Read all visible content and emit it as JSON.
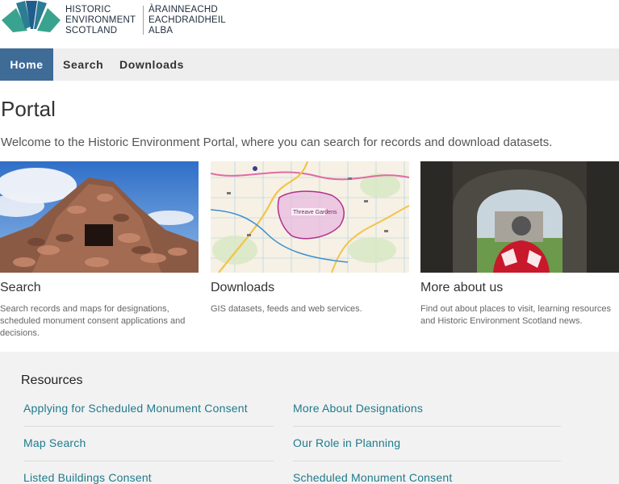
{
  "brand": {
    "en_lines": [
      "HISTORIC",
      "ENVIRONMENT",
      "SCOTLAND"
    ],
    "gd_lines": [
      "ÀRAINNEACHD",
      "EACHDRAIDHEIL",
      "ALBA"
    ]
  },
  "nav": {
    "items": [
      {
        "label": "Home",
        "active": true
      },
      {
        "label": "Search",
        "active": false
      },
      {
        "label": "Downloads",
        "active": false
      }
    ]
  },
  "page": {
    "title": "Portal",
    "intro": "Welcome to the Historic Environment Portal, where you can search for records and download datasets."
  },
  "cards": [
    {
      "title": "Search",
      "description": "Search records and maps for designations, scheduled monument consent applications and decisions."
    },
    {
      "title": "Downloads",
      "description": "GIS datasets, feeds and web services."
    },
    {
      "title": "More about us",
      "description": "Find out about places to visit, learning resources and Historic Environment Scotland news."
    }
  ],
  "map_labels": {
    "place": "Threave Gardens"
  },
  "resources": {
    "heading": "Resources",
    "links": [
      "Applying for Scheduled Monument Consent",
      "More About Designations",
      "Map Search",
      "Our Role in Planning",
      "Listed Buildings Consent",
      "Scheduled Monument Consent"
    ]
  },
  "colors": {
    "nav_active": "#3f6b97",
    "link": "#1f7a8c",
    "logo_teal": "#3aa38f",
    "logo_blue": "#1f5e8c"
  }
}
